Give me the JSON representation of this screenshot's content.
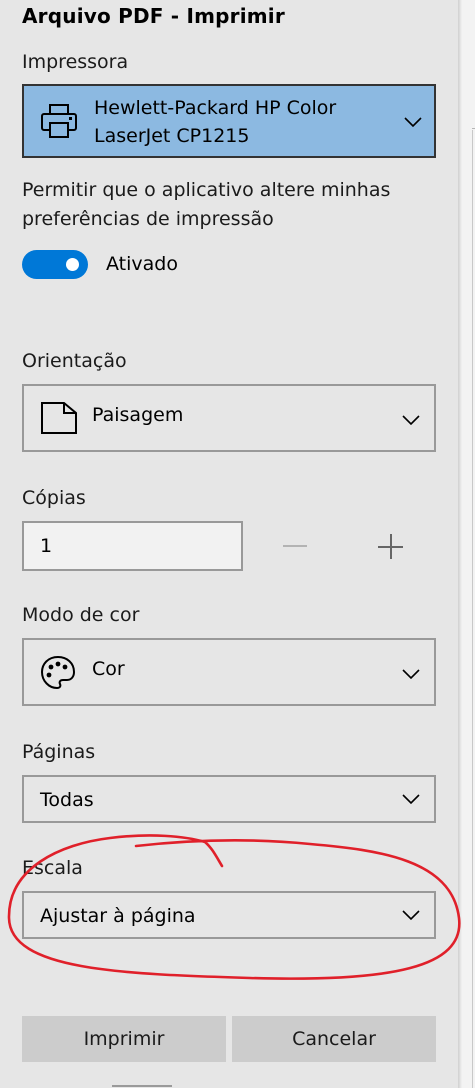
{
  "dialog": {
    "title": "Arquivo PDF - Imprimir"
  },
  "printer": {
    "label": "Impressora",
    "name_line1": "Hewlett-Packard HP Color",
    "name_line2": "LaserJet CP1215",
    "icon": "printer-icon"
  },
  "preferences": {
    "description": "Permitir que o aplicativo altere minhas preferências de impressão",
    "toggle_label": "Ativado",
    "toggle_on": true
  },
  "orientation": {
    "label": "Orientação",
    "value": "Paisagem",
    "icon": "landscape-page-icon"
  },
  "copies": {
    "label": "Cópias",
    "value": "1"
  },
  "color_mode": {
    "label": "Modo de cor",
    "value": "Cor",
    "icon": "palette-icon"
  },
  "pages": {
    "label": "Páginas",
    "value": "Todas"
  },
  "scale": {
    "label": "Escala",
    "value": "Ajustar à página"
  },
  "buttons": {
    "print": "Imprimir",
    "cancel": "Cancelar"
  },
  "colors": {
    "printer_highlight": "#8cb9e1",
    "toggle_accent": "#0078d7",
    "annotation": "#e0202a"
  }
}
